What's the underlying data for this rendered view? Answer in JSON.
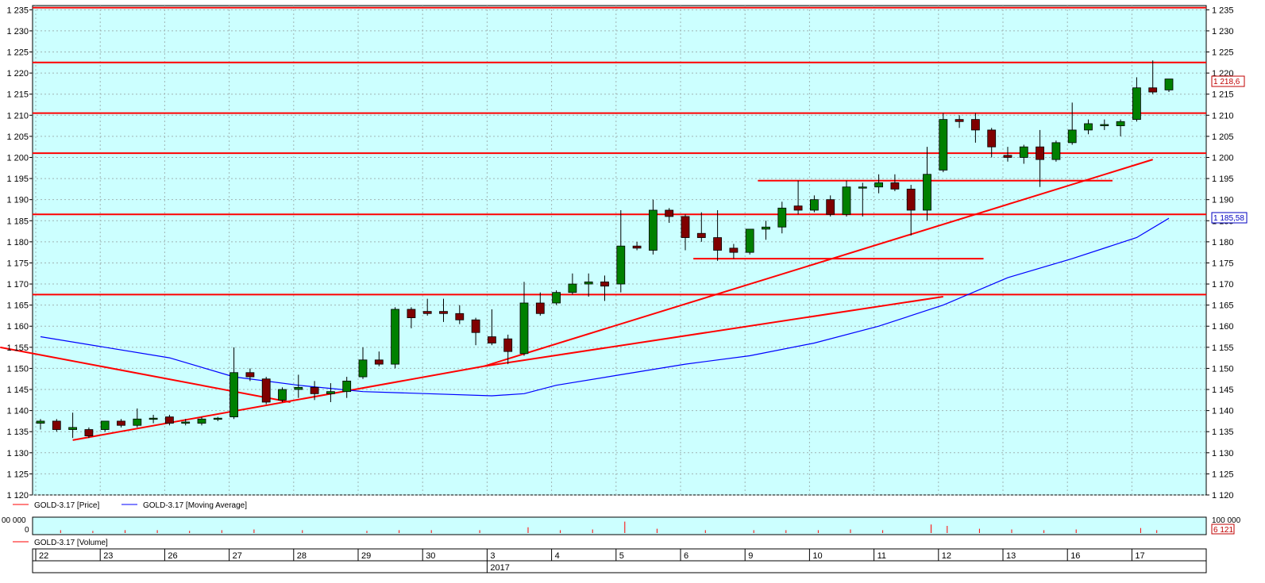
{
  "colors": {
    "plot_bg": "#ccffff",
    "grid": "#a0b4b4",
    "up": "#008000",
    "down": "#800000",
    "support_line": "#ff0000",
    "moving_average": "#0000ff",
    "axis_bg": "#ffffff",
    "price_badge_text": "#c00000",
    "ma_badge_text": "#0000c0"
  },
  "chart_data": {
    "type": "candlestick",
    "title": "",
    "ylim": [
      1120,
      1236
    ],
    "yticks": [
      1120,
      1125,
      1130,
      1135,
      1140,
      1145,
      1150,
      1155,
      1160,
      1165,
      1170,
      1175,
      1180,
      1185,
      1190,
      1195,
      1200,
      1205,
      1210,
      1215,
      1220,
      1225,
      1230,
      1235
    ],
    "ytick_labels": [
      "1 120",
      "1 125",
      "1 130",
      "1 135",
      "1 140",
      "1 145",
      "1 150",
      "1 155",
      "1 160",
      "1 165",
      "1 170",
      "1 175",
      "1 180",
      "1 185",
      "1 190",
      "1 195",
      "1 200",
      "1 205",
      "1 210",
      "1 215",
      "1 220",
      "1 225",
      "1 230",
      "1 235"
    ],
    "bars_count": 62,
    "day_labels": [
      {
        "label": "22",
        "bar": 0
      },
      {
        "label": "23",
        "bar": 4
      },
      {
        "label": "26",
        "bar": 8
      },
      {
        "label": "27",
        "bar": 12
      },
      {
        "label": "28",
        "bar": 16
      },
      {
        "label": "29",
        "bar": 20
      },
      {
        "label": "30",
        "bar": 24
      },
      {
        "label": "3",
        "bar": 28
      },
      {
        "label": "4",
        "bar": 32
      },
      {
        "label": "5",
        "bar": 36
      },
      {
        "label": "6",
        "bar": 40
      },
      {
        "label": "9",
        "bar": 44
      },
      {
        "label": "10",
        "bar": 48
      },
      {
        "label": "11",
        "bar": 52
      },
      {
        "label": "12",
        "bar": 56
      },
      {
        "label": "13",
        "bar": 60
      },
      {
        "label": "16",
        "bar": 64
      },
      {
        "label": "17",
        "bar": 68
      }
    ],
    "year_label": {
      "label": "2017",
      "bar": 28
    },
    "candles": [
      {
        "open": 1137.0,
        "high": 1138.0,
        "low": 1135.5,
        "close": 1137.5
      },
      {
        "open": 1137.5,
        "high": 1138.0,
        "low": 1135.0,
        "close": 1135.5
      },
      {
        "open": 1135.5,
        "high": 1139.5,
        "low": 1133.5,
        "close": 1136.0
      },
      {
        "open": 1135.5,
        "high": 1136.0,
        "low": 1133.5,
        "close": 1134.0
      },
      {
        "open": 1135.5,
        "high": 1137.5,
        "low": 1135.0,
        "close": 1137.5
      },
      {
        "open": 1137.5,
        "high": 1138.0,
        "low": 1136.0,
        "close": 1136.5
      },
      {
        "open": 1136.5,
        "high": 1140.5,
        "low": 1136.0,
        "close": 1138.0
      },
      {
        "open": 1138.0,
        "high": 1139.0,
        "low": 1137.0,
        "close": 1138.2
      },
      {
        "open": 1138.5,
        "high": 1139.0,
        "low": 1136.5,
        "close": 1137.0
      },
      {
        "open": 1137.0,
        "high": 1138.0,
        "low": 1136.5,
        "close": 1137.3
      },
      {
        "open": 1137.0,
        "high": 1138.5,
        "low": 1136.5,
        "close": 1138.0
      },
      {
        "open": 1138.0,
        "high": 1138.5,
        "low": 1137.5,
        "close": 1138.2
      },
      {
        "open": 1138.5,
        "high": 1155.0,
        "low": 1138.0,
        "close": 1149.0
      },
      {
        "open": 1149.0,
        "high": 1150.0,
        "low": 1147.0,
        "close": 1148.0
      },
      {
        "open": 1147.5,
        "high": 1148.0,
        "low": 1141.5,
        "close": 1142.0
      },
      {
        "open": 1142.5,
        "high": 1145.5,
        "low": 1142.0,
        "close": 1145.0
      },
      {
        "open": 1145.0,
        "high": 1148.5,
        "low": 1143.0,
        "close": 1145.5
      },
      {
        "open": 1145.5,
        "high": 1147.0,
        "low": 1142.5,
        "close": 1144.0
      },
      {
        "open": 1144.0,
        "high": 1146.5,
        "low": 1142.0,
        "close": 1144.5
      },
      {
        "open": 1144.5,
        "high": 1148.0,
        "low": 1143.0,
        "close": 1147.0
      },
      {
        "open": 1148.0,
        "high": 1155.0,
        "low": 1147.5,
        "close": 1152.0
      },
      {
        "open": 1152.0,
        "high": 1154.0,
        "low": 1150.5,
        "close": 1151.0
      },
      {
        "open": 1151.0,
        "high": 1164.5,
        "low": 1150.0,
        "close": 1164.0
      },
      {
        "open": 1164.0,
        "high": 1164.5,
        "low": 1159.5,
        "close": 1162.0
      },
      {
        "open": 1163.5,
        "high": 1166.5,
        "low": 1162.5,
        "close": 1163.0
      },
      {
        "open": 1163.5,
        "high": 1166.5,
        "low": 1161.0,
        "close": 1163.0
      },
      {
        "open": 1163.0,
        "high": 1165.0,
        "low": 1160.5,
        "close": 1161.5
      },
      {
        "open": 1161.5,
        "high": 1162.0,
        "low": 1155.5,
        "close": 1158.5
      },
      {
        "open": 1157.5,
        "high": 1164.0,
        "low": 1155.5,
        "close": 1156.0
      },
      {
        "open": 1157.0,
        "high": 1158.0,
        "low": 1151.0,
        "close": 1154.0
      },
      {
        "open": 1153.5,
        "high": 1170.5,
        "low": 1153.0,
        "close": 1165.5
      },
      {
        "open": 1165.5,
        "high": 1168.0,
        "low": 1162.5,
        "close": 1163.0
      },
      {
        "open": 1165.5,
        "high": 1168.5,
        "low": 1165.0,
        "close": 1168.0
      },
      {
        "open": 1168.0,
        "high": 1172.5,
        "low": 1167.5,
        "close": 1170.0
      },
      {
        "open": 1170.0,
        "high": 1172.5,
        "low": 1167.0,
        "close": 1170.5
      },
      {
        "open": 1170.5,
        "high": 1172.0,
        "low": 1166.0,
        "close": 1169.5
      },
      {
        "open": 1170.0,
        "high": 1187.5,
        "low": 1168.0,
        "close": 1179.0
      },
      {
        "open": 1179.0,
        "high": 1180.0,
        "low": 1178.0,
        "close": 1178.5
      },
      {
        "open": 1178.0,
        "high": 1190.0,
        "low": 1177.0,
        "close": 1187.5
      },
      {
        "open": 1187.5,
        "high": 1188.0,
        "low": 1184.5,
        "close": 1186.0
      },
      {
        "open": 1186.0,
        "high": 1186.5,
        "low": 1178.0,
        "close": 1181.0
      },
      {
        "open": 1182.0,
        "high": 1187.0,
        "low": 1180.0,
        "close": 1181.0
      },
      {
        "open": 1181.0,
        "high": 1187.5,
        "low": 1175.5,
        "close": 1178.0
      },
      {
        "open": 1178.5,
        "high": 1179.5,
        "low": 1176.0,
        "close": 1177.5
      },
      {
        "open": 1177.5,
        "high": 1183.0,
        "low": 1177.0,
        "close": 1183.0
      },
      {
        "open": 1183.0,
        "high": 1185.0,
        "low": 1180.5,
        "close": 1183.5
      },
      {
        "open": 1183.5,
        "high": 1189.5,
        "low": 1182.0,
        "close": 1188.0
      },
      {
        "open": 1188.5,
        "high": 1194.5,
        "low": 1186.5,
        "close": 1187.5
      },
      {
        "open": 1187.5,
        "high": 1191.0,
        "low": 1187.0,
        "close": 1190.0
      },
      {
        "open": 1190.0,
        "high": 1191.0,
        "low": 1186.0,
        "close": 1186.5
      },
      {
        "open": 1186.5,
        "high": 1194.5,
        "low": 1186.0,
        "close": 1193.0
      },
      {
        "open": 1193.0,
        "high": 1194.0,
        "low": 1186.0,
        "close": 1193.0
      },
      {
        "open": 1193.0,
        "high": 1196.0,
        "low": 1191.5,
        "close": 1194.0
      },
      {
        "open": 1194.0,
        "high": 1196.0,
        "low": 1192.0,
        "close": 1192.5
      },
      {
        "open": 1192.5,
        "high": 1193.5,
        "low": 1181.5,
        "close": 1187.5
      },
      {
        "open": 1187.5,
        "high": 1202.5,
        "low": 1185.0,
        "close": 1196.0
      },
      {
        "open": 1197.0,
        "high": 1210.5,
        "low": 1196.5,
        "close": 1209.0
      },
      {
        "open": 1209.0,
        "high": 1210.0,
        "low": 1207.0,
        "close": 1208.5
      },
      {
        "open": 1209.0,
        "high": 1210.5,
        "low": 1203.5,
        "close": 1206.5
      },
      {
        "open": 1206.5,
        "high": 1207.0,
        "low": 1200.0,
        "close": 1202.5
      },
      {
        "open": 1200.5,
        "high": 1202.5,
        "low": 1199.0,
        "close": 1200.0
      },
      {
        "open": 1200.0,
        "high": 1203.0,
        "low": 1198.5,
        "close": 1202.5
      }
    ],
    "candles_extra": [
      {
        "open": 1202.5,
        "high": 1206.5,
        "low": 1193.0,
        "close": 1199.5
      },
      {
        "open": 1199.5,
        "high": 1204.0,
        "low": 1199.0,
        "close": 1203.5
      },
      {
        "open": 1203.5,
        "high": 1213.0,
        "low": 1203.0,
        "close": 1206.5
      },
      {
        "open": 1206.5,
        "high": 1209.0,
        "low": 1205.5,
        "close": 1208.0
      },
      {
        "open": 1207.5,
        "high": 1209.0,
        "low": 1206.5,
        "close": 1207.8
      },
      {
        "open": 1207.5,
        "high": 1209.0,
        "low": 1205.0,
        "close": 1208.5
      },
      {
        "open": 1209.0,
        "high": 1219.0,
        "low": 1208.5,
        "close": 1216.5
      },
      {
        "open": 1216.5,
        "high": 1223.0,
        "low": 1215.0,
        "close": 1215.5
      },
      {
        "open": 1216.0,
        "high": 1218.6,
        "low": 1215.5,
        "close": 1218.6
      }
    ],
    "moving_average": [
      [
        0,
        1157.5
      ],
      [
        4,
        1155.0
      ],
      [
        8,
        1152.5
      ],
      [
        12,
        1148.0
      ],
      [
        16,
        1146.0
      ],
      [
        20,
        1144.5
      ],
      [
        24,
        1144.0
      ],
      [
        28,
        1143.5
      ],
      [
        30,
        1144.0
      ],
      [
        32,
        1146.0
      ],
      [
        36,
        1148.5
      ],
      [
        40,
        1151.0
      ],
      [
        44,
        1153.0
      ],
      [
        48,
        1156.0
      ],
      [
        52,
        1160.0
      ],
      [
        56,
        1165.0
      ],
      [
        60,
        1171.5
      ],
      [
        64,
        1176.0
      ],
      [
        68,
        1181.0
      ],
      [
        70,
        1185.58
      ]
    ],
    "horizontal_lines": [
      1235.5,
      1222.5,
      1210.5,
      1201.0,
      1186.5,
      1167.5
    ],
    "segments": [
      {
        "from": [
          -2.5,
          1155.0
        ],
        "to": [
          15.5,
          1142.0
        ]
      },
      {
        "from": [
          2.0,
          1133.0
        ],
        "to": [
          27.5,
          1150.5
        ]
      },
      {
        "from": [
          27.5,
          1150.5
        ],
        "to": [
          56.0,
          1167.0
        ]
      },
      {
        "from": [
          27.5,
          1150.5
        ],
        "to": [
          69.0,
          1199.5
        ]
      },
      {
        "from": [
          40.5,
          1176.0
        ],
        "to": [
          58.5,
          1176.0
        ]
      },
      {
        "from": [
          44.5,
          1194.5
        ],
        "to": [
          66.5,
          1194.5
        ]
      }
    ],
    "price_series_label": "GOLD-3.17 [Price]",
    "ma_series_label": "GOLD-3.17 [Moving Average]",
    "last_price_label": "1 218,6",
    "ma_value_label": "1 185,58",
    "volume": {
      "series_label": "GOLD-3.17 [Volume]",
      "left_top_label": "00 000",
      "left_zero_label": "0",
      "right_max_label": "100 000",
      "right_value_label": "6 121",
      "spikes": [
        [
          1,
          0.2
        ],
        [
          3,
          0.15
        ],
        [
          5,
          0.2
        ],
        [
          7,
          0.2
        ],
        [
          9,
          0.15
        ],
        [
          11,
          0.2
        ],
        [
          13,
          0.25
        ],
        [
          16,
          0.2
        ],
        [
          20,
          0.15
        ],
        [
          22,
          0.2
        ],
        [
          24,
          0.2
        ],
        [
          27,
          0.2
        ],
        [
          30,
          0.4
        ],
        [
          32,
          0.2
        ],
        [
          34,
          0.25
        ],
        [
          36,
          0.8
        ],
        [
          38,
          0.3
        ],
        [
          41,
          0.2
        ],
        [
          44,
          0.2
        ],
        [
          46,
          0.2
        ],
        [
          48,
          0.2
        ],
        [
          50,
          0.25
        ],
        [
          52,
          0.2
        ],
        [
          55,
          0.6
        ],
        [
          56,
          0.5
        ],
        [
          58,
          0.3
        ],
        [
          60,
          0.25
        ],
        [
          62,
          0.2
        ],
        [
          64,
          0.25
        ],
        [
          68,
          0.35
        ],
        [
          69,
          0.2
        ]
      ]
    }
  }
}
